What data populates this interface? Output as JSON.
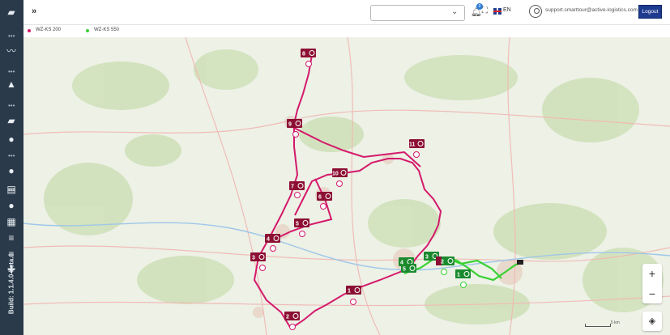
{
  "sidebar": {
    "build_label": "Build: 1.1.4.0-beta.6",
    "icons": [
      "truck-icon",
      "chart-icon",
      "road-icon",
      "delivery-icon",
      "user-icon",
      "database-icon",
      "user-group-icon",
      "building-icon",
      "list-icon",
      "list-alt-icon",
      "puzzle-icon"
    ]
  },
  "topbar": {
    "expand_label": "»",
    "select_value": "",
    "notification_count": "0",
    "language": "EN",
    "email": "support.smarttour@active-logistics.com",
    "logout_label": "Logout"
  },
  "legend": {
    "items": [
      {
        "label": "WZ-KS 200",
        "color": "#d4196b"
      },
      {
        "label": "WZ-KS 550",
        "color": "#39d133"
      }
    ]
  },
  "map": {
    "magenta_stops": [
      {
        "label": "8"
      },
      {
        "label": "9"
      },
      {
        "label": "11"
      },
      {
        "label": "10"
      },
      {
        "label": "7"
      },
      {
        "label": "6"
      },
      {
        "label": "5"
      },
      {
        "label": "4"
      },
      {
        "label": "3"
      },
      {
        "label": "1"
      },
      {
        "label": "2"
      }
    ],
    "green_stops": [
      {
        "label": "4"
      },
      {
        "label": "5"
      },
      {
        "label": "3"
      },
      {
        "label": "2"
      },
      {
        "label": "1"
      }
    ],
    "zoom_in": "+",
    "zoom_out": "−",
    "scale_label": "5 km",
    "colors": {
      "route_magenta": "#d4196b",
      "route_green": "#39d133",
      "stop_magenta": "#8c1034",
      "stop_green": "#1b8a2e"
    }
  }
}
